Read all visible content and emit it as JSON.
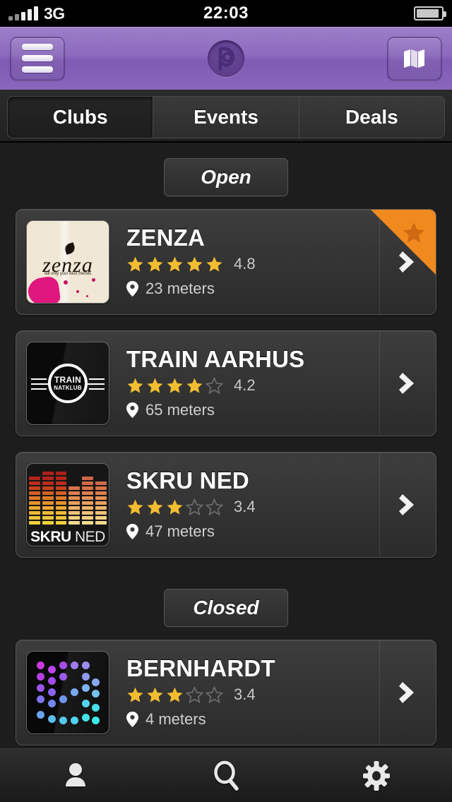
{
  "status_bar": {
    "carrier": "3G",
    "time": "22:03",
    "signal_bars_total": 5,
    "signal_bars_on": 3,
    "battery_level_pct": 92
  },
  "nav_bar": {
    "menu_icon": "hamburger-icon",
    "logo_letter": "p",
    "map_icon": "map-icon",
    "accent_color": "#8a67bd"
  },
  "tabs": {
    "items": [
      {
        "label": "Clubs",
        "active": true
      },
      {
        "label": "Events",
        "active": false
      },
      {
        "label": "Deals",
        "active": false
      }
    ]
  },
  "sections": [
    {
      "header": "Open",
      "venues": [
        {
          "name": "ZENZA",
          "rating": 4.8,
          "rating_text": "4.8",
          "stars_filled": 5,
          "stars_total": 5,
          "distance": "23 meters",
          "featured": true,
          "logo": "zenza-logo",
          "logo_text": "zenza",
          "logo_tagline": "tell only your best friends"
        },
        {
          "name": "TRAIN AARHUS",
          "rating": 4.2,
          "rating_text": "4.2",
          "stars_filled": 4,
          "stars_total": 5,
          "distance": "65 meters",
          "featured": false,
          "logo": "train-natklub-logo",
          "logo_text": "TRAIN",
          "logo_subtext": "NATKLUB"
        },
        {
          "name": "SKRU NED",
          "rating": 3.4,
          "rating_text": "3.4",
          "stars_filled": 3,
          "stars_total": 5,
          "distance": "47 meters",
          "featured": false,
          "logo": "skru-ned-equalizer-logo",
          "logo_text": "SKRU",
          "logo_subtext": "NED"
        }
      ]
    },
    {
      "header": "Closed",
      "venues": [
        {
          "name": "BERNHARDT",
          "rating": 3.4,
          "rating_text": "3.4",
          "stars_filled": 3,
          "stars_total": 5,
          "distance": "4 meters",
          "featured": false,
          "logo": "bernhardt-dots-logo"
        }
      ]
    }
  ],
  "bottom_bar": {
    "items": [
      {
        "icon": "person-icon",
        "name": "profile"
      },
      {
        "icon": "search-icon",
        "name": "search"
      },
      {
        "icon": "gear-icon",
        "name": "settings"
      }
    ]
  },
  "colors": {
    "star_filled": "#f2bd30",
    "star_empty": "#6e6e6e",
    "ribbon": "#f08a1e",
    "nav_purple": "#8a67bd",
    "card_bg": "#353535"
  }
}
